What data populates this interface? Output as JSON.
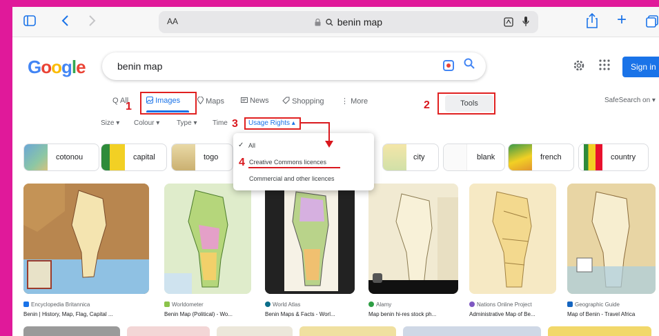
{
  "browser": {
    "aa_label": "AA",
    "url": "benin map",
    "lock_icon": "lock-icon",
    "reader_label": "⊡",
    "colors": {
      "toolbar": "#f7f7f7",
      "accent": "#1a73e8"
    }
  },
  "google": {
    "logo": [
      "G",
      "o",
      "o",
      "g",
      "l",
      "e"
    ],
    "query": "benin map",
    "sign_in": "Sign in"
  },
  "tabs": [
    {
      "label": "Q All",
      "active": false
    },
    {
      "label": "Images",
      "active": true
    },
    {
      "label": "Maps",
      "active": false
    },
    {
      "label": "News",
      "active": false
    },
    {
      "label": "Shopping",
      "active": false
    },
    {
      "label": "More",
      "active": false
    }
  ],
  "tools_label": "Tools",
  "safesearch": "SafeSearch on ▾",
  "filters": [
    {
      "label": "Size ▾"
    },
    {
      "label": "Colour ▾"
    },
    {
      "label": "Type ▾"
    },
    {
      "label": "Time"
    },
    {
      "label": "Usage Rights ▴",
      "active": true
    }
  ],
  "annotations": {
    "n1": "1",
    "n2": "2",
    "n3": "3",
    "n4": "4"
  },
  "chips": [
    {
      "label": "cotonou"
    },
    {
      "label": "capital"
    },
    {
      "label": "togo"
    },
    {
      "label": "city"
    },
    {
      "label": "blank"
    },
    {
      "label": "french"
    },
    {
      "label": "country"
    }
  ],
  "dropdown": {
    "check": "✓",
    "items": [
      "All",
      "Creative Commons licences",
      "Commercial and other licences"
    ]
  },
  "results": [
    {
      "source": "Encyclopedia Britannica",
      "title": "Benin | History, Map, Flag, Capital ...",
      "dot": "#1a73e8"
    },
    {
      "source": "Worldometer",
      "title": "Benin Map (Political) - Wo...",
      "dot": "#8bc34a"
    },
    {
      "source": "World Atlas",
      "title": "Benin Maps & Facts - Worl...",
      "dot": "#0b6e8a"
    },
    {
      "source": "Alamy",
      "title": "Map benin hi-res stock ph...",
      "dot": "#2e9e44"
    },
    {
      "source": "Nations Online Project",
      "title": "Administrative Map of Be...",
      "dot": "#7e57c2"
    },
    {
      "source": "Geographic Guide",
      "title": "Map of Benin - Travel Africa",
      "dot": "#1565c0"
    }
  ]
}
